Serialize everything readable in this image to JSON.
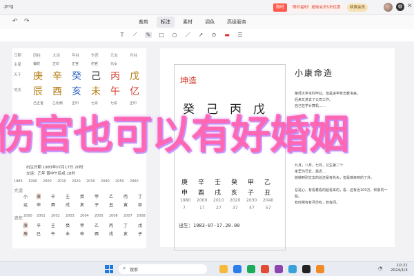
{
  "window": {
    "file_name": ".png",
    "promo_badge": "限时",
    "promo_text": "限时福利！超级会员5折优惠",
    "member_label": "续费会员",
    "settings_icon": "gear-icon",
    "close_icon": "close-icon"
  },
  "toolbar": {
    "undo_icon": "undo-icon",
    "redo_icon": "redo-icon",
    "tabs": [
      {
        "label": "裁剪"
      },
      {
        "label": "标注"
      },
      {
        "label": "素材"
      },
      {
        "label": "调色"
      },
      {
        "label": "高级服务"
      }
    ]
  },
  "drawbar": {
    "tools": [
      "T",
      "⟋",
      "✎",
      "□",
      "○",
      "／",
      "↗",
      "⊙",
      "▬",
      "☰"
    ],
    "active_index": 2
  },
  "left_page": {
    "header": [
      "日期",
      "四柱",
      "大运",
      "年柱",
      "伤官",
      "元女",
      "月柱"
    ],
    "row_labels": [
      "主星",
      "天干",
      "地支"
    ],
    "stars": [
      "偏财",
      "正印",
      "正官",
      "伤官",
      "元女"
    ],
    "stems": [
      "庚",
      "辛",
      "癸",
      "己",
      "丙",
      "戊"
    ],
    "branches": [
      "辰",
      "酉",
      "亥",
      "未",
      "午",
      "亿"
    ],
    "small_notes": [
      "己正官",
      "乙比肩",
      "正印",
      "七杀",
      "七杀",
      "正印"
    ],
    "info_1": "出生日期 1983年07月17日 20时",
    "info_2": "交运：乙年 寅中午后戌 18时",
    "ages": [
      "1983",
      "1990",
      "2000",
      "2010",
      "2020",
      "2030",
      "2040",
      "2050",
      "2060"
    ],
    "dayun_label": "大运",
    "dayun": [
      "小",
      "庚",
      "辛",
      "壬",
      "癸",
      "甲",
      "乙",
      "丙",
      "丁"
    ],
    "dayun_branches": [
      "运",
      "申",
      "酉",
      "戌",
      "亥",
      "子",
      "丑",
      "寅",
      "卯"
    ],
    "liunian_label": "流年",
    "years": [
      "2000",
      "2001",
      "2002",
      "2003",
      "2004",
      "2005",
      "2006",
      "2007",
      "2008"
    ],
    "liunian_stems": [
      "庚",
      "辛",
      "壬",
      "癸",
      "甲",
      "乙",
      "丙",
      "丁",
      "戊"
    ],
    "liunian_branches": [
      "辰",
      "巳",
      "午",
      "未",
      "申",
      "酉",
      "戌",
      "亥",
      "子"
    ]
  },
  "right_page": {
    "box_title": "坤造",
    "main_stems": [
      "癸",
      "己",
      "丙",
      "戊"
    ],
    "sub_stems": [
      "庚",
      "辛",
      "壬",
      "癸",
      "甲",
      "乙"
    ],
    "sub_branches": [
      "申",
      "酉",
      "戌",
      "亥",
      "子",
      "丑"
    ],
    "years": [
      "1980",
      "2000",
      "2010",
      "2020",
      "2030",
      "2040"
    ],
    "ages": [
      "7",
      "17",
      "27",
      "37",
      "47",
      "57"
    ],
    "birth_line": "出生：1983-07-17.20.00",
    "doc_title": "小康命造",
    "doc_lines": [
      "某师大学本科毕业。但是进学校去教书来。",
      "后来又进去了公司工作。",
      "自己在学计算机……",
      "",
      "",
      "九月，八月，七月，又生第二个",
      "家里为兄长，最近…",
      "她嫁到别文去的总还是有先夫，但是嫁来到的了外。",
      "总是心。有看着看的起看来的，看…还有近100万，积累的一些。",
      "有时候有有月份有，有有间。"
    ]
  },
  "overlay": {
    "caption": "伤官也可以有好婚姻"
  },
  "taskbar": {
    "search_label": "搜索",
    "start_icon": "windows-start-icon",
    "search_icon": "search-icon",
    "time": "10:21",
    "date": "2024/1/3",
    "app_colors": [
      "#f6b93b",
      "#2b7de9",
      "#1cab58",
      "#e34a33",
      "#8e44ad",
      "#3aa1d8",
      "#222222",
      "#f08a24"
    ]
  }
}
